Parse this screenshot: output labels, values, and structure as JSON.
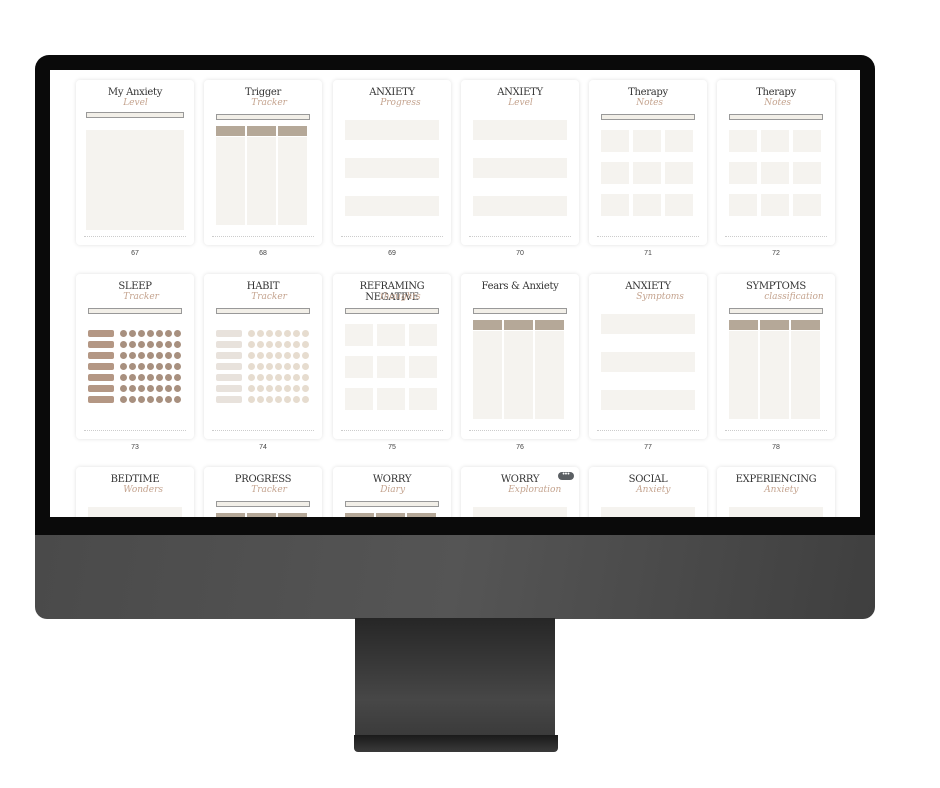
{
  "pages": [
    {
      "number": "67",
      "title": "My Anxiety",
      "script": "Level",
      "layout": "box"
    },
    {
      "number": "68",
      "title": "Trigger",
      "script": "Tracker",
      "layout": "table"
    },
    {
      "number": "69",
      "title": "ANXIETY",
      "script": "Progress",
      "layout": "sections"
    },
    {
      "number": "70",
      "title": "ANXIETY",
      "script": "Level",
      "layout": "sections"
    },
    {
      "number": "71",
      "title": "Therapy",
      "script": "Notes",
      "layout": "grid"
    },
    {
      "number": "72",
      "title": "Therapy",
      "script": "Notes",
      "layout": "grid"
    },
    {
      "number": "73",
      "title": "SLEEP",
      "script": "Tracker",
      "layout": "dots"
    },
    {
      "number": "74",
      "title": "HABIT",
      "script": "Tracker",
      "layout": "dots"
    },
    {
      "number": "75",
      "title": "REFRAMING NEGATIVE",
      "script": "thoughts",
      "layout": "grid"
    },
    {
      "number": "76",
      "title": "Fears & Anxiety",
      "script": "",
      "layout": "table"
    },
    {
      "number": "77",
      "title": "ANXIETY",
      "script": "Symptoms",
      "layout": "sections"
    },
    {
      "number": "78",
      "title": "SYMPTOMS",
      "script": "classification",
      "layout": "table"
    },
    {
      "number": "",
      "title": "BEDTIME",
      "script": "Wonders",
      "layout": "sections"
    },
    {
      "number": "",
      "title": "PROGRESS",
      "script": "Tracker",
      "layout": "table"
    },
    {
      "number": "",
      "title": "WORRY",
      "script": "Diary",
      "layout": "table"
    },
    {
      "number": "",
      "title": "WORRY",
      "script": "Exploration",
      "layout": "sections"
    },
    {
      "number": "",
      "title": "SOCIAL",
      "script": "Anxiety",
      "layout": "sections"
    },
    {
      "number": "",
      "title": "EXPERIENCING",
      "script": "Anxiety",
      "layout": "sections"
    }
  ],
  "more_button": "•••",
  "colors": {
    "accent": "#b5a898",
    "script": "#c4a38e",
    "bezel": "#0a0a0a",
    "chin": "#4a4a4a"
  }
}
